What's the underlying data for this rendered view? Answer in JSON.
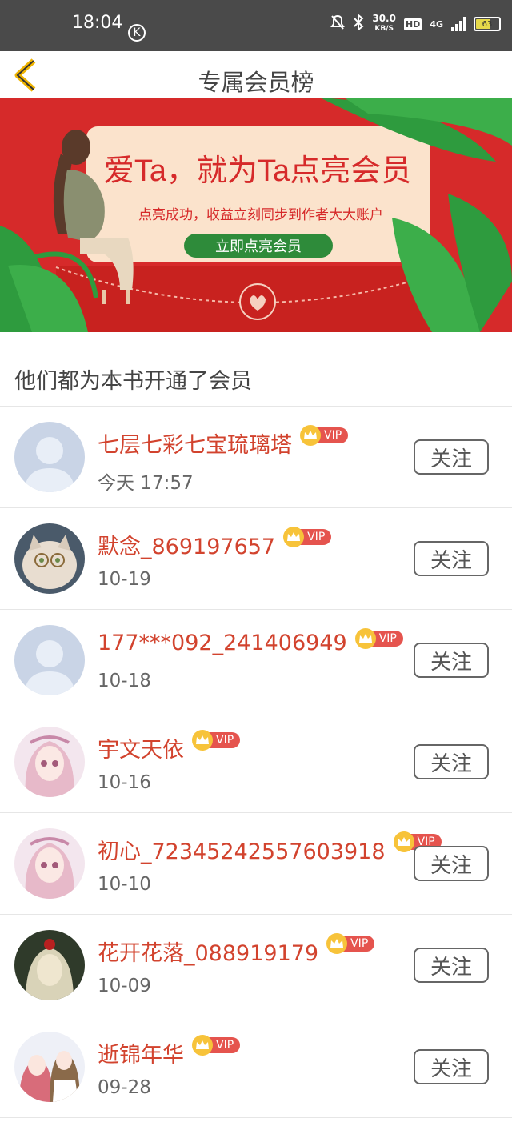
{
  "status_bar": {
    "time": "18:04",
    "k_label": "K",
    "speed_value": "30.0",
    "speed_unit": "KB/S",
    "hd_label": "HD",
    "network_label": "4G",
    "battery": "63"
  },
  "header": {
    "title": "专属会员榜"
  },
  "banner": {
    "headline": "爱Ta，就为Ta点亮会员",
    "subline": "点亮成功，收益立刻同步到作者大大账户",
    "cta": "立即点亮会员"
  },
  "section_title": "他们都为本书开通了会员",
  "members": [
    {
      "name": "七层七彩七宝琉璃塔",
      "date": "今天 17:57",
      "vip": "VIP",
      "follow": "关注",
      "avatar": "default-avatar"
    },
    {
      "name": "默念_869197657",
      "date": "10-19",
      "vip": "VIP",
      "follow": "关注",
      "avatar": "cat-avatar"
    },
    {
      "name": "177***092_241406949",
      "date": "10-18",
      "vip": "VIP",
      "follow": "关注",
      "avatar": "default-avatar"
    },
    {
      "name": "宇文天依",
      "date": "10-16",
      "vip": "VIP",
      "follow": "关注",
      "avatar": "anime-girl-avatar"
    },
    {
      "name": "初心_72345242557603918",
      "date": "10-10",
      "vip": "VIP",
      "follow": "关注",
      "avatar": "anime-girl-avatar"
    },
    {
      "name": "花开花落_088919179",
      "date": "10-09",
      "vip": "VIP",
      "follow": "关注",
      "avatar": "portrait-avatar"
    },
    {
      "name": "逝锦年华",
      "date": "09-28",
      "vip": "VIP",
      "follow": "关注",
      "avatar": "anime-couple-avatar"
    }
  ],
  "colors": {
    "status_bar": "#4a4a4a",
    "accent_name": "#d2432e",
    "banner_red": "#d62a2a",
    "back_arrow": "#f0b400",
    "vip_crown": "#f7c33a",
    "vip_label": "#e5544e"
  }
}
